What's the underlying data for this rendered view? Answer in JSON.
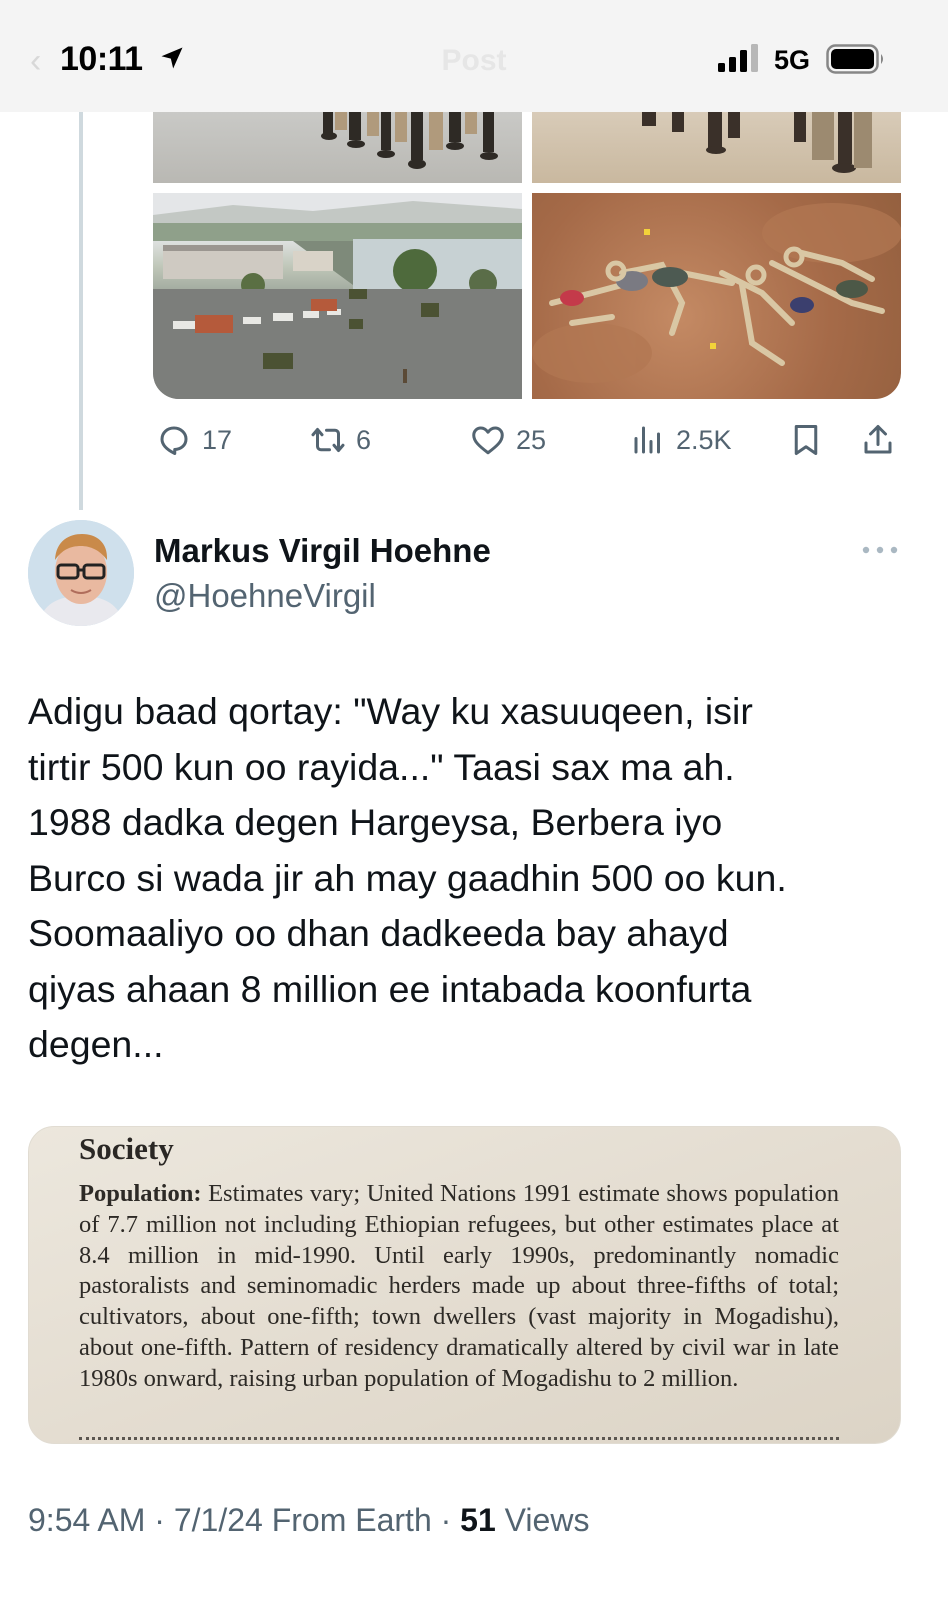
{
  "status_bar": {
    "time": "10:11",
    "network": "5G",
    "header_title": "Post"
  },
  "icons": {
    "location": "location-arrow-icon",
    "signal": "cellular-signal-icon",
    "battery": "battery-icon",
    "reply": "reply-icon",
    "repost": "repost-icon",
    "like": "heart-icon",
    "views": "analytics-icon",
    "bookmark": "bookmark-icon",
    "share": "share-icon",
    "more": "more-icon"
  },
  "previous_post": {
    "actions": {
      "replies": "17",
      "reposts": "6",
      "likes": "25",
      "views": "2.5K"
    }
  },
  "post": {
    "author": {
      "name": "Markus Virgil Hoehne",
      "handle": "@HoehneVirgil"
    },
    "text": "Adigu baad qortay: \"Way ku xasuuqeen, isir\ntirtir 500 kun oo rayida...\" Taasi sax ma ah.\n1988 dadka degen Hargeysa, Berbera iyo\nBurco si wada jir ah may gaadhin 500 oo kun.\nSoomaaliyo oo dhan dadkeeda bay ahayd\nqiyas ahaan 8 million ee intabada koonfurta\ndegen...",
    "image_text": {
      "heading": "Society",
      "label": "Population:",
      "body": " Estimates vary; United Nations 1991 estimate shows population of 7.7 million not including Ethiopian refugees, but other estimates place at 8.4 million in mid-1990. Until early 1990s, predominantly nomadic pastoralists and seminomadic herders made up about three-fifths of total; cultivators, about one-fifth; town dwellers (vast majority in Mogadishu), about one-fifth. Pattern of residency dramatically altered by civil war in late 1980s onward, raising urban population of Mogadishu to 2 million."
    },
    "meta": {
      "time": "9:54 AM",
      "sep1": "·",
      "date": "7/1/24",
      "source": "From Earth",
      "sep2": "·",
      "views_count": "51",
      "views_label": "Views"
    }
  },
  "colors": {
    "text_primary": "#0f1419",
    "text_secondary": "#536471",
    "thread_line": "#cfd9de"
  }
}
